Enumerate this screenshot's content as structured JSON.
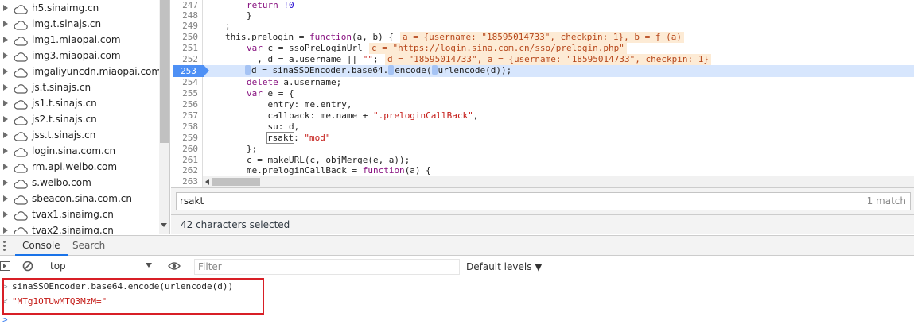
{
  "file_tree": {
    "items": [
      {
        "label": "h5.sinaimg.cn"
      },
      {
        "label": "img.t.sinajs.cn"
      },
      {
        "label": "img1.miaopai.com"
      },
      {
        "label": "img3.miaopai.com"
      },
      {
        "label": "imgaliyuncdn.miaopai.com"
      },
      {
        "label": "js.t.sinajs.cn"
      },
      {
        "label": "js1.t.sinajs.cn"
      },
      {
        "label": "js2.t.sinajs.cn"
      },
      {
        "label": "jss.t.sinajs.cn"
      },
      {
        "label": "login.sina.com.cn"
      },
      {
        "label": "rm.api.weibo.com"
      },
      {
        "label": "s.weibo.com"
      },
      {
        "label": "sbeacon.sina.com.cn"
      },
      {
        "label": "tvax1.sinaimg.cn"
      },
      {
        "label": "tvax2.sinaimg.cn"
      }
    ]
  },
  "code": {
    "line_numbers": [
      "247",
      "248",
      "249",
      "250",
      "251",
      "252",
      "253",
      "254",
      "255",
      "256",
      "257",
      "258",
      "259",
      "260",
      "261",
      "262",
      "263"
    ],
    "current_line": "253",
    "lines": {
      "l247a": "return ",
      "l247b": "!0",
      "l248": "}",
      "l249": ";",
      "l250a": "this.prelogin = ",
      "l250b": "function",
      "l250c": "(a, b) {",
      "l251a": "var",
      "l251b": " c = ssoPreLoginUrl",
      "l252a": "  , d = a.username || ",
      "l252b": "\"\"",
      "l252c": ";",
      "l253a": "d = sinaSSOEncoder.base64.",
      "l253b": "encode(",
      "l253c": "urlencode(d));",
      "l254a": "delete",
      "l254b": " a.username;",
      "l255a": "var",
      "l255b": " e = {",
      "l256": "    entry: me.entry,",
      "l257a": "    callback: me.name + ",
      "l257b": "\".preloginCallBack\"",
      "l257c": ",",
      "l258": "    su: d,",
      "l259a": "rsakt",
      "l259b": ": ",
      "l259c": "\"mod\"",
      "l260": "};",
      "l261": "c = makeURL(c, objMerge(e, a));",
      "l262a": "me.preloginCallBack = ",
      "l262b": "function",
      "l262c": "(a) {"
    },
    "inline_values": {
      "v250": "a = {username: \"18595014733\", checkpin: 1}, b = ƒ (a)",
      "v251": "c = \"https://login.sina.com.cn/sso/prelogin.php\"",
      "v252": "d = \"18595014733\", a = {username: \"18595014733\", checkpin: 1}"
    }
  },
  "search": {
    "query": "rsakt",
    "match_count": "1 match"
  },
  "status": {
    "selection": "42 characters selected"
  },
  "drawer": {
    "tabs": {
      "console": "Console",
      "search": "Search"
    }
  },
  "console_toolbar": {
    "context": "top",
    "filter_placeholder": "Filter",
    "levels": "Default levels ▼"
  },
  "console": {
    "input": "sinaSSOEncoder.base64.encode(urlencode(d))",
    "output": "\"MTg1OTUwMTQ3MzM=\""
  },
  "colors": {
    "accent": "#1a73e8",
    "highlight_box": "#d81f26",
    "string": "#c41a16"
  }
}
